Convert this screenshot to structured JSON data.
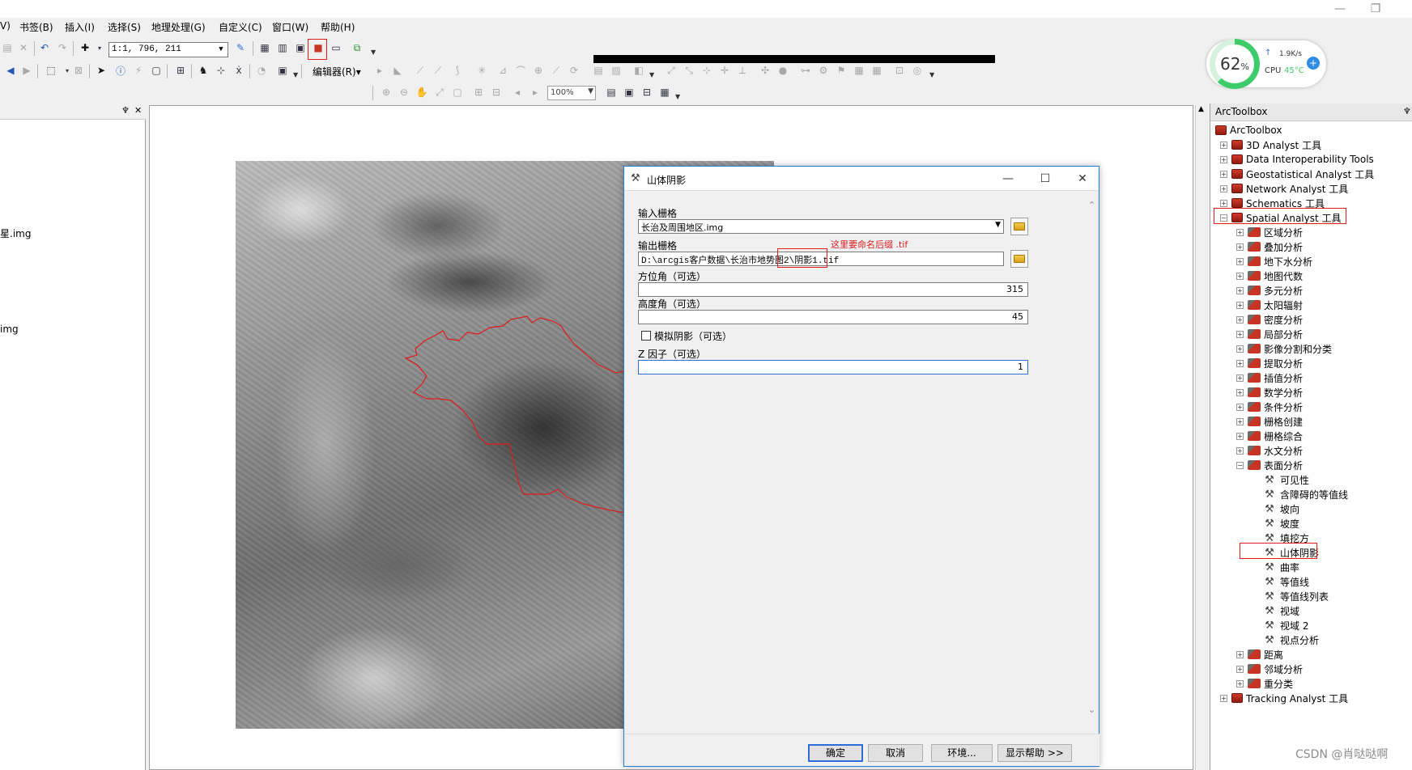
{
  "window": {
    "minimize": "—",
    "restore": "❐"
  },
  "menu": [
    "V)",
    "书签(B)",
    "插入(I)",
    "选择(S)",
    "地理处理(G)",
    "自定义(C)",
    "窗口(W)",
    "帮助(H)"
  ],
  "toolbar": {
    "scale_value": "1:1, 796, 211",
    "editor_label": "编辑器(R)▾",
    "zoom_value": "100%"
  },
  "system_monitor": {
    "cpu_percent": 62,
    "cpu_display": "62",
    "percent_sign": "%",
    "net_speed": "1.9K/s",
    "cpu_label": "CPU",
    "cpu_temp": "45°C",
    "accent": "#3ecb6a"
  },
  "toc": {
    "pin": "♆",
    "close": "✕",
    "items": [
      "星.img",
      "img"
    ]
  },
  "toolbox": {
    "title": "ArcToolbox",
    "pin": "♆",
    "root": "ArcToolbox",
    "toolsets": [
      "3D Analyst 工具",
      "Data Interoperability Tools",
      "Geostatistical Analyst 工具",
      "Network Analyst 工具",
      "Schematics 工具",
      "Spatial Analyst 工具"
    ],
    "spatial_children": [
      "区域分析",
      "叠加分析",
      "地下水分析",
      "地图代数",
      "多元分析",
      "太阳辐射",
      "密度分析",
      "局部分析",
      "影像分割和分类",
      "提取分析",
      "插值分析",
      "数学分析",
      "条件分析",
      "栅格创建",
      "栅格综合",
      "水文分析",
      "表面分析"
    ],
    "surface_tools": [
      "可见性",
      "含障碍的等值线",
      "坡向",
      "坡度",
      "填挖方",
      "山体阴影",
      "曲率",
      "等值线",
      "等值线列表",
      "视域",
      "视域 2",
      "视点分析"
    ],
    "after": [
      "距离",
      "邻域分析",
      "重分类"
    ],
    "last": "Tracking Analyst 工具"
  },
  "dialog": {
    "title": "山体阴影",
    "input_label": "输入栅格",
    "input_value": "长治及周围地区.img",
    "output_label": "输出栅格",
    "output_value": "D:\\arcgis客户数据\\长治市地势图2\\阴影1.tif",
    "annotation": "这里要命名后缀 .tif",
    "azimuth_label": "方位角（可选）",
    "azimuth_value": "315",
    "altitude_label": "高度角（可选）",
    "altitude_value": "45",
    "shadow_label": "模拟阴影（可选）",
    "shadow_checked": false,
    "z_label": "Z 因子（可选）",
    "z_value": "1",
    "ok": "确定",
    "cancel": "取消",
    "env": "环境...",
    "help": "显示帮助 >>"
  },
  "watermark": "CSDN @肖哒哒啊",
  "colors": {
    "highlight": "#e21b1b",
    "accent": "#1f7fd9"
  }
}
